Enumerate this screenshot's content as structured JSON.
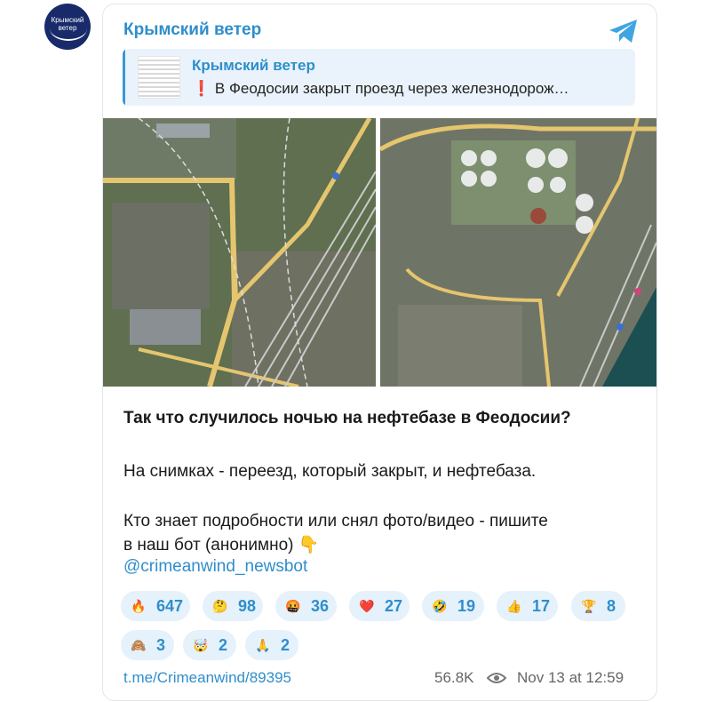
{
  "avatar": {
    "text_line1": "Крымский",
    "text_line2": "ветер"
  },
  "post": {
    "channel_name": "Крымский ветер",
    "reply": {
      "name": "Крымский ветер",
      "text": "❗ В Феодосии закрыт проезд через железнодорож…"
    },
    "body": {
      "line1": "Так что случилось ночью на нефтебазе в Феодосии?",
      "line2": "На снимках - переезд, который закрыт, и нефтебаза.",
      "line3": "Кто знает подробности или снял фото/видео - пишите",
      "line4": "в наш бот (анонимно) 👇",
      "bot_link": "@crimeanwind_newsbot"
    },
    "reactions": [
      {
        "emoji": "🔥",
        "icon": "fire-icon",
        "count": "647"
      },
      {
        "emoji": "🤔",
        "icon": "thinking-face-icon",
        "count": "98"
      },
      {
        "emoji": "🤬",
        "icon": "swearing-face-icon",
        "count": "36"
      },
      {
        "emoji": "❤️",
        "icon": "heart-icon",
        "count": "27"
      },
      {
        "emoji": "🤣",
        "icon": "rolling-laughing-icon",
        "count": "19"
      },
      {
        "emoji": "👍",
        "icon": "thumbs-up-icon",
        "count": "17"
      },
      {
        "emoji": "🏆",
        "icon": "trophy-icon",
        "count": "8"
      },
      {
        "emoji": "🙈",
        "icon": "see-no-evil-monkey-icon",
        "count": "3"
      },
      {
        "emoji": "🤯",
        "icon": "exploding-head-icon",
        "count": "2"
      },
      {
        "emoji": "🙏",
        "icon": "folded-hands-icon",
        "count": "2"
      }
    ],
    "footer": {
      "post_link": "t.me/Crimeanwind/89395",
      "views": "56.8K",
      "date": "Nov 13 at 12:59"
    }
  },
  "colors": {
    "accent": "#2f8ecb",
    "reaction_bg": "#e5f1fb",
    "reply_bg": "#eaf3fb",
    "avatar_bg": "#182a6a",
    "telegram_blue": "#40a4e3"
  }
}
